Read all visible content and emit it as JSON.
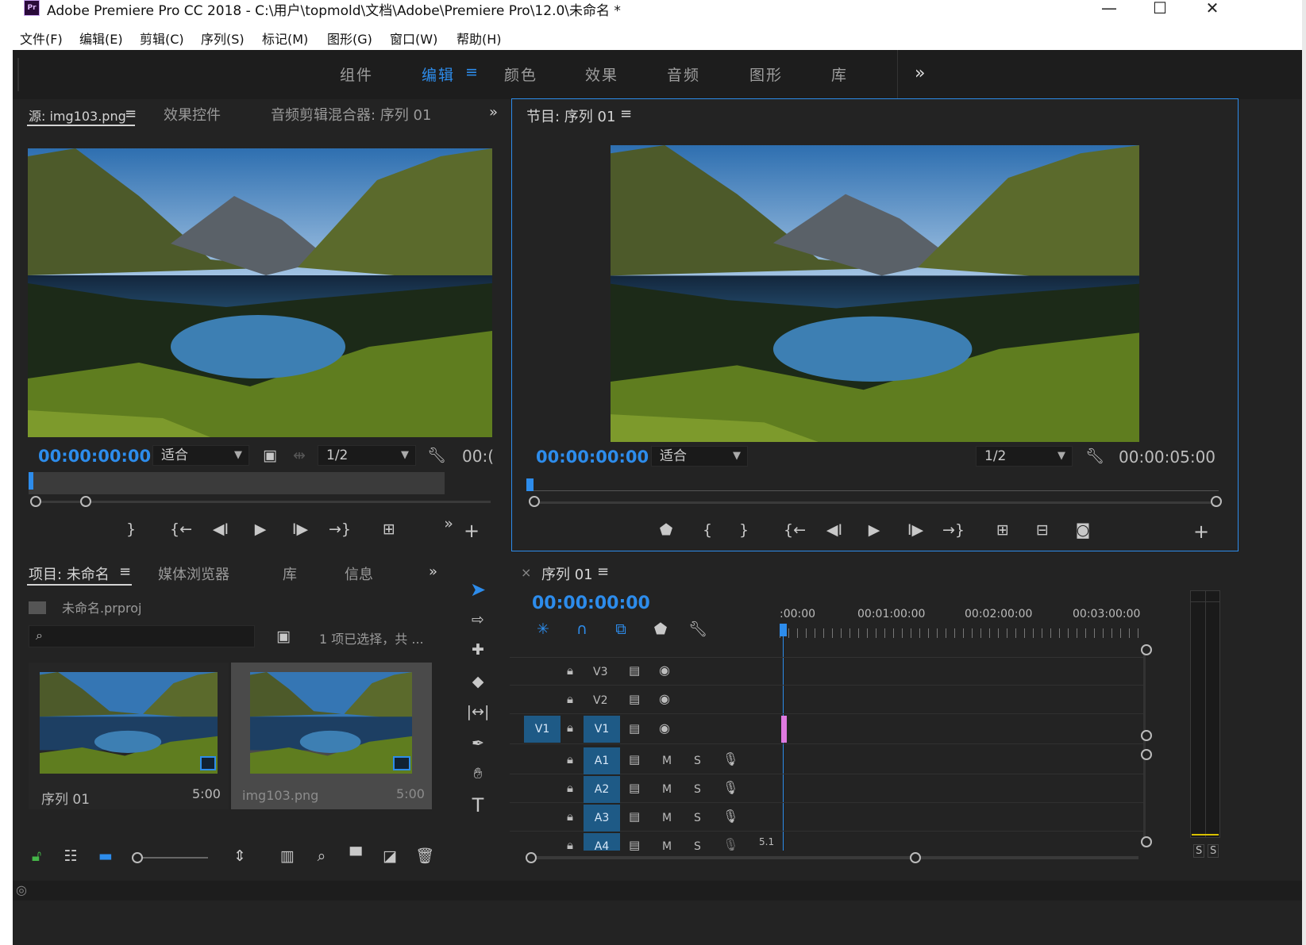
{
  "titlebar": {
    "logo": "Pr",
    "title": "Adobe Premiere Pro CC 2018 - C:\\用户\\topmold\\文档\\Adobe\\Premiere Pro\\12.0\\未命名 *",
    "minimize": "—",
    "maximize": "☐",
    "close": "✕"
  },
  "menu": [
    "文件(F)",
    "编辑(E)",
    "剪辑(C)",
    "序列(S)",
    "标记(M)",
    "图形(G)",
    "窗口(W)",
    "帮助(H)"
  ],
  "workspaces": {
    "items": [
      "组件",
      "编辑",
      "颜色",
      "效果",
      "音频",
      "图形",
      "库"
    ],
    "active": "编辑",
    "overflow": "»",
    "menu_icon": "≡"
  },
  "source_panel": {
    "tabs": [
      "源: img103.png",
      "效果控件",
      "音频剪辑混合器: 序列 01"
    ],
    "tab_menu": "≡",
    "overflow": "»",
    "timecode": "00:00:00:00",
    "fit": "适合",
    "resolution": "1/2",
    "duration_clipped": "00:("
  },
  "program_panel": {
    "title": "节目: 序列 01",
    "tab_menu": "≡",
    "timecode": "00:00:00:00",
    "fit": "适合",
    "resolution": "1/2",
    "duration": "00:00:05:00"
  },
  "project_panel": {
    "tabs": [
      "项目: 未命名",
      "媒体浏览器",
      "库",
      "信息"
    ],
    "tab_menu": "≡",
    "overflow": "»",
    "project_file": "未命名.prproj",
    "selection_status": "1 项已选择，共 ...",
    "items": [
      {
        "name": "序列 01",
        "duration": "5:00"
      },
      {
        "name": "img103.png",
        "duration": "5:00"
      }
    ]
  },
  "tools": [
    "selection-tool",
    "track-select-tool",
    "ripple-edit-tool",
    "razor-tool",
    "slip-tool",
    "pen-tool",
    "hand-tool",
    "type-tool"
  ],
  "timeline": {
    "close": "×",
    "title": "序列 01",
    "tab_menu": "≡",
    "timecode": "00:00:00:00",
    "ruler": [
      ":00:00",
      "00:01:00:00",
      "00:02:00:00",
      "00:03:00:00"
    ],
    "video_tracks": [
      {
        "name": "V3",
        "source": ""
      },
      {
        "name": "V2",
        "source": ""
      },
      {
        "name": "V1",
        "source": "V1"
      }
    ],
    "audio_tracks": [
      {
        "name": "A1",
        "m": "M",
        "s": "S"
      },
      {
        "name": "A2",
        "m": "M",
        "s": "S"
      },
      {
        "name": "A3",
        "m": "M",
        "s": "S"
      },
      {
        "name": "A4",
        "m": "M",
        "s": "S"
      }
    ],
    "mix_value": "5.1"
  },
  "audio_meter": {
    "solo_left": "S",
    "solo_right": "S"
  },
  "colors": {
    "accent": "#2d8ceb",
    "panel": "#232323",
    "clip_marker": "#e07ae0"
  }
}
